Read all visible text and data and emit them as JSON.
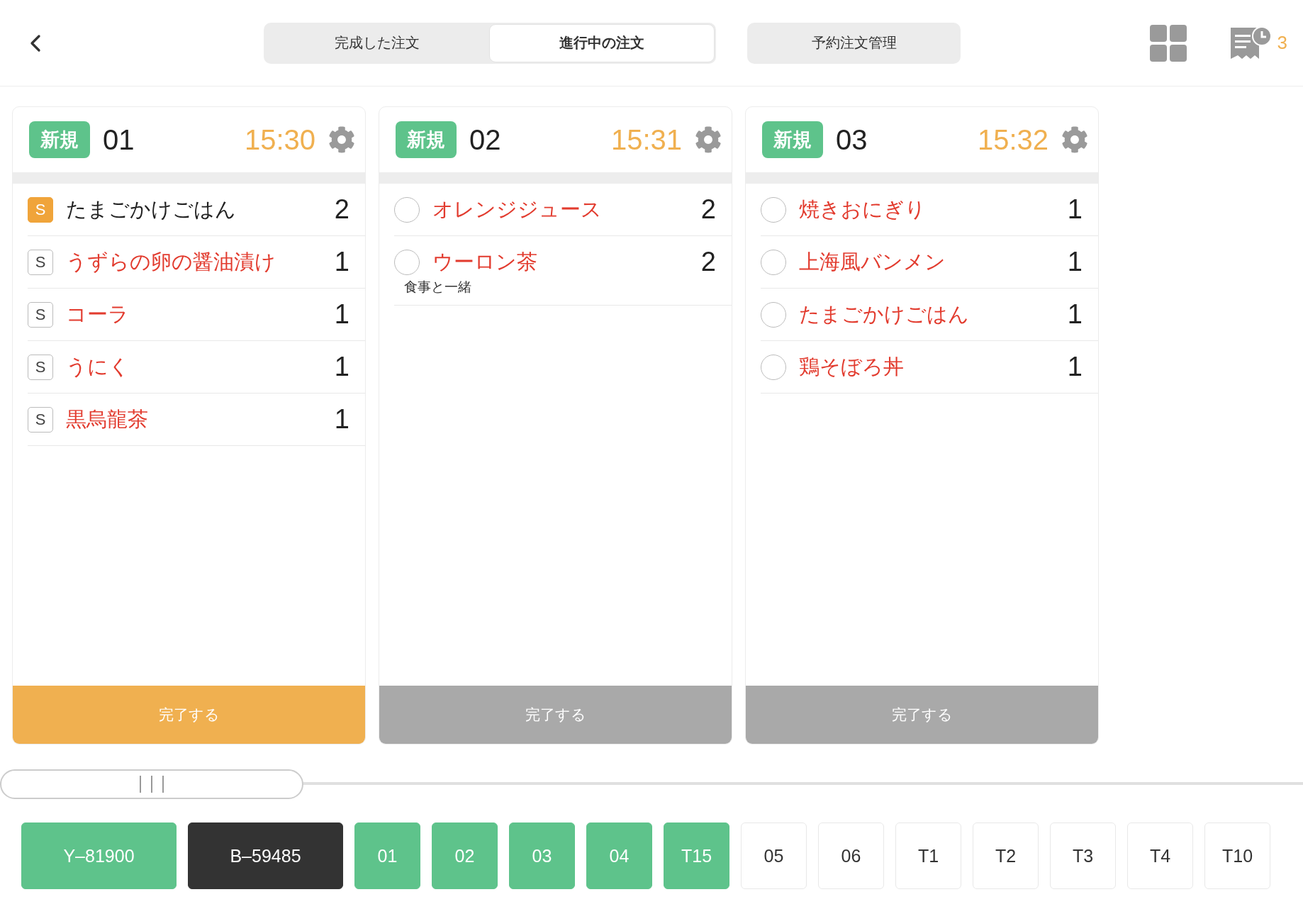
{
  "header": {
    "tabs": [
      {
        "label": "完成した注文",
        "selected": false
      },
      {
        "label": "進行中の注文",
        "selected": true
      }
    ],
    "reservation_button": "予約注文管理",
    "pending_count": "3"
  },
  "orders": [
    {
      "tag": "新規",
      "number": "01",
      "time": "15:30",
      "items": [
        {
          "kind": "s-tag",
          "tag": "S",
          "name": "たまごかけごはん",
          "qty": "2",
          "highlighted": true
        },
        {
          "kind": "s-tag",
          "tag": "S",
          "name": "うずらの卵の醤油漬け",
          "qty": "1",
          "highlighted": false
        },
        {
          "kind": "s-tag",
          "tag": "S",
          "name": "コーラ",
          "qty": "1",
          "highlighted": false
        },
        {
          "kind": "s-tag",
          "tag": "S",
          "name": "うにく",
          "qty": "1",
          "highlighted": false
        },
        {
          "kind": "s-tag",
          "tag": "S",
          "name": "黒烏龍茶",
          "qty": "1",
          "highlighted": false
        }
      ],
      "finish": {
        "label": "完了する",
        "enabled": true
      }
    },
    {
      "tag": "新規",
      "number": "02",
      "time": "15:31",
      "items": [
        {
          "kind": "circle",
          "name": "オレンジジュース",
          "qty": "2",
          "checked": false
        },
        {
          "kind": "circle",
          "name": "ウーロン茶",
          "qty": "2",
          "checked": false,
          "note": "食事と一緒"
        }
      ],
      "finish": {
        "label": "完了する",
        "enabled": false
      }
    },
    {
      "tag": "新規",
      "number": "03",
      "time": "15:32",
      "items": [
        {
          "kind": "circle",
          "name": "焼きおにぎり",
          "qty": "1",
          "checked": false
        },
        {
          "kind": "circle",
          "name": "上海風バンメン",
          "qty": "1",
          "checked": false
        },
        {
          "kind": "circle",
          "name": "たまごかけごはん",
          "qty": "1",
          "checked": false
        },
        {
          "kind": "circle",
          "name": "鶏そぼろ丼",
          "qty": "1",
          "checked": false
        }
      ],
      "finish": {
        "label": "完了する",
        "enabled": false
      }
    }
  ],
  "tables": [
    {
      "label": "Y–81900",
      "kind": "reservation"
    },
    {
      "label": "B–59485",
      "kind": "billing"
    },
    {
      "label": "01",
      "kind": "occupied"
    },
    {
      "label": "02",
      "kind": "occupied"
    },
    {
      "label": "03",
      "kind": "occupied"
    },
    {
      "label": "04",
      "kind": "occupied"
    },
    {
      "label": "T15",
      "kind": "occupied"
    },
    {
      "label": "05",
      "kind": "free"
    },
    {
      "label": "06",
      "kind": "free"
    },
    {
      "label": "T1",
      "kind": "free"
    },
    {
      "label": "T2",
      "kind": "free"
    },
    {
      "label": "T3",
      "kind": "free"
    },
    {
      "label": "T4",
      "kind": "free"
    },
    {
      "label": "T10",
      "kind": "free"
    }
  ]
}
